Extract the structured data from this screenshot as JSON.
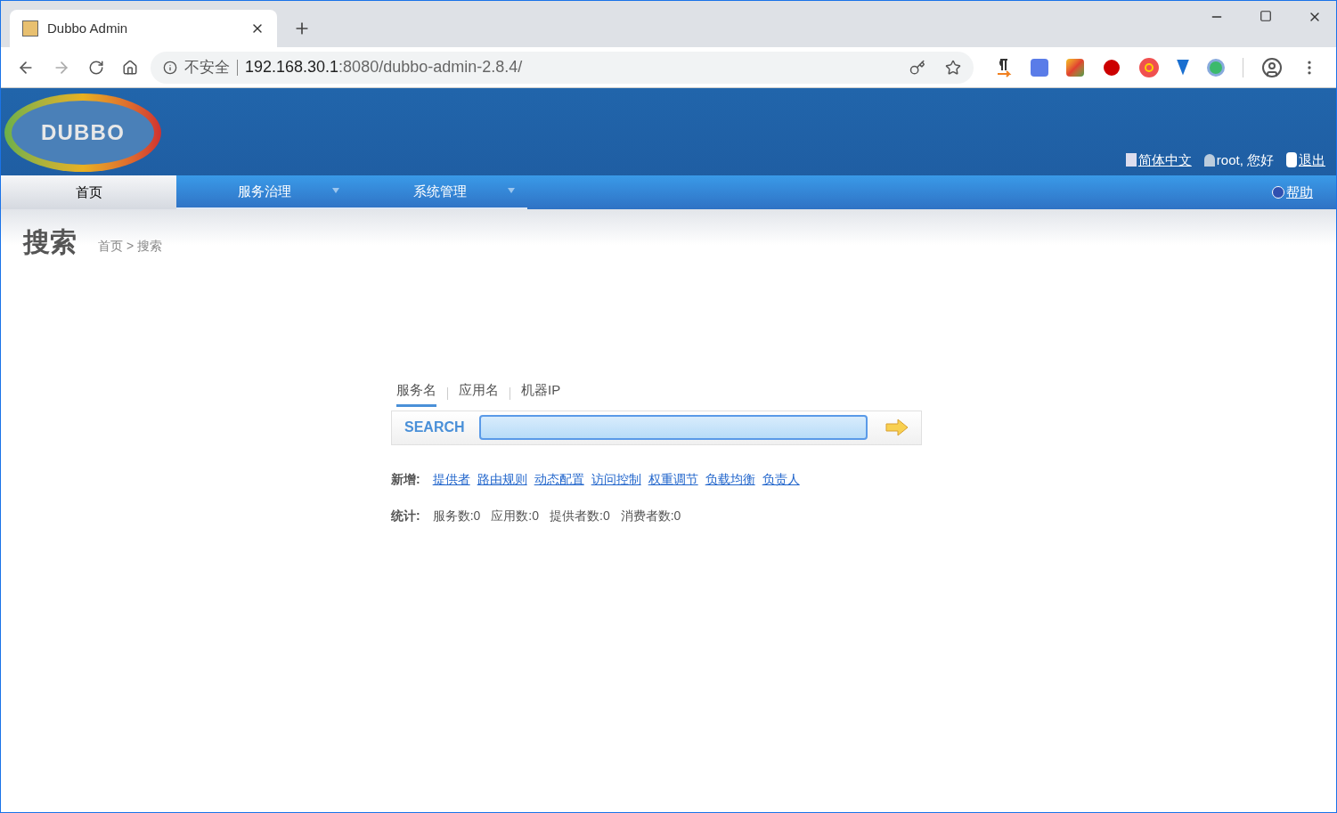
{
  "browser": {
    "tab_title": "Dubbo Admin",
    "security": "不安全",
    "url_host": "192.168.30.1",
    "url_rest": ":8080/dubbo-admin-2.8.4/"
  },
  "header": {
    "logo": "DUBBO",
    "language": "简体中文",
    "greeting": "root, 您好",
    "logout": "退出"
  },
  "nav": {
    "items": [
      {
        "label": "首页",
        "selected": true,
        "dropdown": false
      },
      {
        "label": "服务治理",
        "selected": false,
        "dropdown": true
      },
      {
        "label": "系统管理",
        "selected": false,
        "dropdown": true
      }
    ],
    "help": "帮助"
  },
  "page": {
    "title": "搜索",
    "breadcrumb": "首页 > 搜索"
  },
  "search": {
    "tabs": [
      {
        "label": "服务名",
        "selected": true
      },
      {
        "label": "应用名",
        "selected": false
      },
      {
        "label": "机器IP",
        "selected": false
      }
    ],
    "label": "SEARCH"
  },
  "add": {
    "label": "新增:",
    "links": [
      "提供者",
      "路由规则",
      "动态配置",
      "访问控制",
      "权重调节",
      "负载均衡",
      "负责人"
    ]
  },
  "stats": {
    "label": "统计:",
    "items": [
      "服务数:0",
      "应用数:0",
      "提供者数:0",
      "消费者数:0"
    ]
  }
}
